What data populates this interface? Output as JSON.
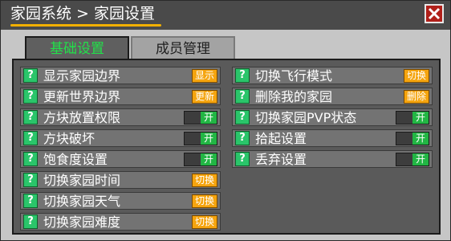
{
  "window": {
    "title": "家园系统 > 家园设置"
  },
  "tabs": [
    {
      "label": "基础设置",
      "active": true
    },
    {
      "label": "成员管理",
      "active": false
    }
  ],
  "left_settings": [
    {
      "label": "显示家园边界",
      "control": "button",
      "button_label": "显示"
    },
    {
      "label": "更新世界边界",
      "control": "button",
      "button_label": "更新"
    },
    {
      "label": "方块放置权限",
      "control": "toggle",
      "toggle_label": "开"
    },
    {
      "label": "方块破坏",
      "control": "toggle",
      "toggle_label": "开"
    },
    {
      "label": "饱食度设置",
      "control": "toggle",
      "toggle_label": "开"
    },
    {
      "label": "切换家园时间",
      "control": "button",
      "button_label": "切换"
    },
    {
      "label": "切换家园天气",
      "control": "button",
      "button_label": "切换"
    },
    {
      "label": "切换家园难度",
      "control": "button",
      "button_label": "切换"
    }
  ],
  "right_settings": [
    {
      "label": "切换飞行模式",
      "control": "button",
      "button_label": "切换"
    },
    {
      "label": "删除我的家园",
      "control": "button",
      "button_label": "删除"
    },
    {
      "label": "切换家园PVP状态",
      "control": "toggle",
      "toggle_label": "开"
    },
    {
      "label": "拾起设置",
      "control": "toggle",
      "toggle_label": "开"
    },
    {
      "label": "丢弃设置",
      "control": "toggle",
      "toggle_label": "开"
    }
  ],
  "help_icon_text": "?",
  "colors": {
    "accent_green": "#22e04a",
    "button_orange": "#f5a40e",
    "toggle_green": "#22b644",
    "title_underline": "#f2b000",
    "close_red": "#b0201a"
  }
}
